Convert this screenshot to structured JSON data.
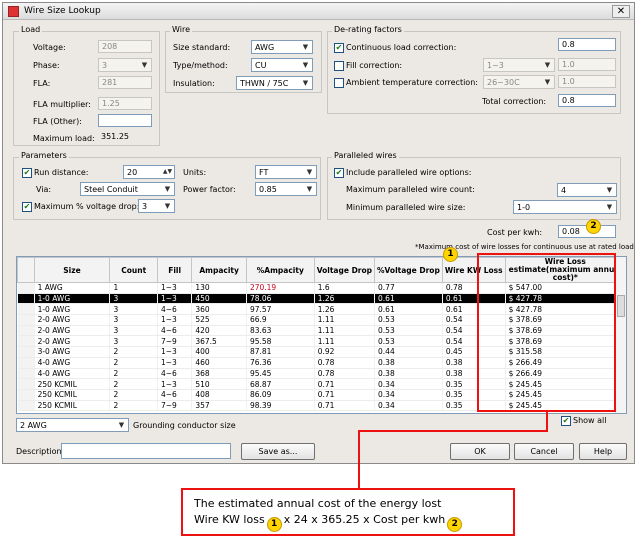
{
  "window": {
    "title": "Wire Size Lookup",
    "close_glyph": "✕"
  },
  "load": {
    "group_label": "Load",
    "voltage_label": "Voltage:",
    "voltage_value": "208",
    "phase_label": "Phase:",
    "phase_value": "3",
    "fla_label": "FLA:",
    "fla_value": "281",
    "fla_multiplier_label": "FLA multiplier:",
    "fla_multiplier_value": "1.25",
    "fla_other_label": "FLA (Other):",
    "fla_other_value": "",
    "max_load_label": "Maximum load:",
    "max_load_value": "351.25"
  },
  "wire": {
    "group_label": "Wire",
    "size_standard_label": "Size standard:",
    "size_standard_value": "AWG",
    "type_method_label": "Type/method:",
    "type_method_value": "CU",
    "insulation_label": "Insulation:",
    "insulation_value": "THWN / 75C"
  },
  "derating": {
    "group_label": "De-rating factors",
    "continuous_label": "Continuous load correction:",
    "continuous_checked": true,
    "continuous_value": "0.8",
    "fill_label": "Fill correction:",
    "fill_checked": false,
    "fill_select": "1~3",
    "fill_value": "1.0",
    "ambient_label": "Ambient temperature correction:",
    "ambient_checked": false,
    "ambient_select": "26~30C",
    "ambient_value": "1.0",
    "total_label": "Total correction:",
    "total_value": "0.8"
  },
  "parameters": {
    "group_label": "Parameters",
    "run_distance_label": "Run distance:",
    "run_distance_checked": true,
    "run_distance_value": "20",
    "units_label": "Units:",
    "units_value": "FT",
    "via_label": "Via:",
    "via_value": "Steel Conduit",
    "power_factor_label": "Power factor:",
    "power_factor_value": "0.85",
    "max_vdrop_label": "Maximum % voltage drop:",
    "max_vdrop_checked": true,
    "max_vdrop_value": "3"
  },
  "paralleled": {
    "group_label": "Paralleled wires",
    "include_label": "Include paralleled wire options:",
    "include_checked": true,
    "max_count_label": "Maximum paralleled wire count:",
    "max_count_value": "4",
    "min_size_label": "Minimum paralleled wire size:",
    "min_size_value": "1-0"
  },
  "cost": {
    "label": "Cost per kwh:",
    "value": "0.08"
  },
  "footnote": "*Maximum cost of wire losses for continuous use at rated load",
  "table": {
    "columns": [
      "Size",
      "Count",
      "Fill",
      "Ampacity",
      "%Ampacity",
      "Voltage Drop",
      "%Voltage Drop",
      "Wire KW Loss",
      "Wire Loss estimate(maximum annual cost)*"
    ],
    "rows": [
      [
        "1 AWG",
        "1",
        "1~3",
        "130",
        "270.19",
        "1.6",
        "0.77",
        "0.78",
        "$ 547.00"
      ],
      [
        "1-0 AWG",
        "3",
        "1~3",
        "450",
        "78.06",
        "1.26",
        "0.61",
        "0.61",
        "$ 427.78"
      ],
      [
        "1-0 AWG",
        "3",
        "4~6",
        "360",
        "97.57",
        "1.26",
        "0.61",
        "0.61",
        "$ 427.78"
      ],
      [
        "2-0 AWG",
        "3",
        "1~3",
        "525",
        "66.9",
        "1.11",
        "0.53",
        "0.54",
        "$ 378.69"
      ],
      [
        "2-0 AWG",
        "3",
        "4~6",
        "420",
        "83.63",
        "1.11",
        "0.53",
        "0.54",
        "$ 378.69"
      ],
      [
        "2-0 AWG",
        "3",
        "7~9",
        "367.5",
        "95.58",
        "1.11",
        "0.53",
        "0.54",
        "$ 378.69"
      ],
      [
        "3-0 AWG",
        "2",
        "1~3",
        "400",
        "87.81",
        "0.92",
        "0.44",
        "0.45",
        "$ 315.58"
      ],
      [
        "4-0 AWG",
        "2",
        "1~3",
        "460",
        "76.36",
        "0.78",
        "0.38",
        "0.38",
        "$ 266.49"
      ],
      [
        "4-0 AWG",
        "2",
        "4~6",
        "368",
        "95.45",
        "0.78",
        "0.38",
        "0.38",
        "$ 266.49"
      ],
      [
        "250 KCMIL",
        "2",
        "1~3",
        "510",
        "68.87",
        "0.71",
        "0.34",
        "0.35",
        "$ 245.45"
      ],
      [
        "250 KCMIL",
        "2",
        "4~6",
        "408",
        "86.09",
        "0.71",
        "0.34",
        "0.35",
        "$ 245.45"
      ],
      [
        "250 KCMIL",
        "2",
        "7~9",
        "357",
        "98.39",
        "0.71",
        "0.34",
        "0.35",
        "$ 245.45"
      ]
    ],
    "selected_row": 1,
    "highlight_cell": {
      "row": 0,
      "col": 4
    }
  },
  "grounding": {
    "value": "2 AWG",
    "label": "Grounding conductor size"
  },
  "show_all": {
    "label": "Show all",
    "checked": true
  },
  "description": {
    "label": "Description:",
    "value": ""
  },
  "buttons": {
    "save_as": "Save as...",
    "ok": "OK",
    "cancel": "Cancel",
    "help": "Help"
  },
  "annotations": {
    "badge1": "1",
    "badge2": "2",
    "caption_line1": "The estimated annual cost of the energy lost",
    "caption_prefix": "Wire KW loss",
    "caption_mid": "x 24 x 365.25 x Cost per kwh"
  },
  "icons": {
    "check": "✔",
    "dropdown": "▼",
    "spin": "▲▼"
  }
}
